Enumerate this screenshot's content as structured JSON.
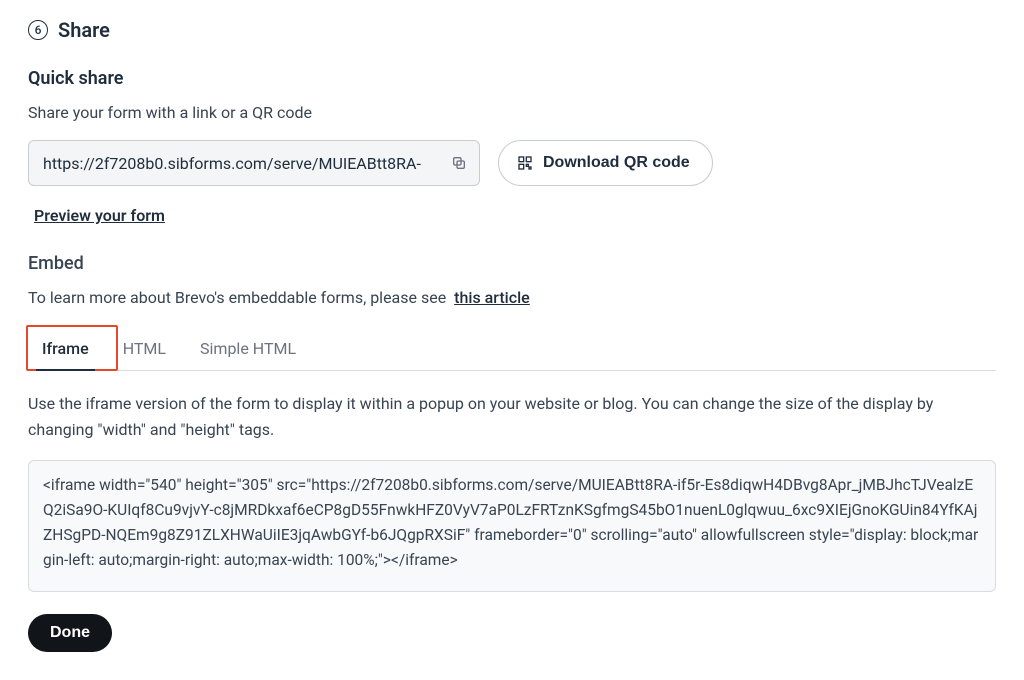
{
  "step": {
    "number": "6",
    "title": "Share"
  },
  "quick_share": {
    "heading": "Quick share",
    "subtext": "Share your form with a link or a QR code",
    "url_value": "https://2f7208b0.sibforms.com/serve/MUIEABtt8RA-",
    "copy_icon_name": "copy-icon",
    "qr_button_label": "Download QR code",
    "qr_icon_name": "qr-code-icon",
    "preview_link": "Preview your form"
  },
  "embed": {
    "heading": "Embed",
    "help_text": "To learn more about Brevo's embeddable forms, please see",
    "help_link_label": "this article",
    "tabs": [
      {
        "label": "Iframe",
        "active": true
      },
      {
        "label": "HTML",
        "active": false
      },
      {
        "label": "Simple HTML",
        "active": false
      }
    ],
    "iframe_description": "Use the iframe version of the form to display it within a popup on your website or blog. You can change the size of the display by changing \"width\" and \"height\" tags.",
    "iframe_code": "<iframe width=\"540\" height=\"305\" src=\"https://2f7208b0.sibforms.com/serve/MUIEABtt8RA-if5r-Es8diqwH4DBvg8Apr_jMBJhcTJVealzEQ2iSa9O-KUIqf8Cu9vjvY-c8jMRDkxaf6eCP8gD55FnwkHFZ0VyV7aP0LzFRTznKSgfmgS45bO1nuenL0glqwuu_6xc9XIEjGnoKGUin84YfKAjZHSgPD-NQEm9g8Z91ZLXHWaUiIE3jqAwbGYf-b6JQgpRXSiF\" frameborder=\"0\" scrolling=\"auto\" allowfullscreen style=\"display: block;margin-left: auto;margin-right: auto;max-width: 100%;\"></iframe>"
  },
  "done_button": "Done"
}
